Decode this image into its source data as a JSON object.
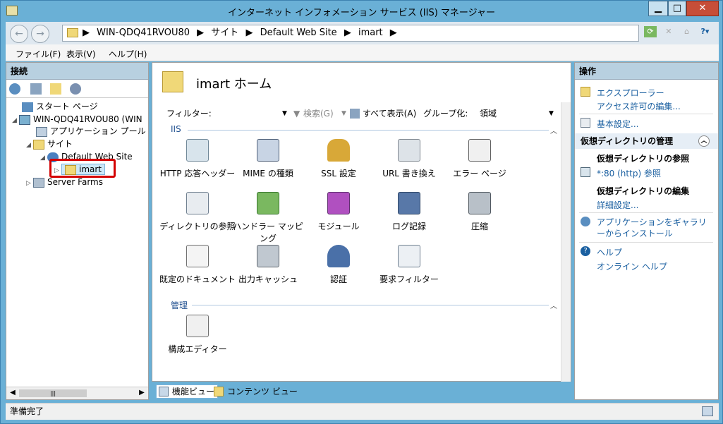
{
  "window": {
    "title": "インターネット インフォメーション サービス (IIS) マネージャー",
    "buttons": {
      "minimize": "▁",
      "maximize": "□",
      "close": "✕"
    }
  },
  "address": {
    "crumbs": [
      "WIN-QDQ41RVOU80",
      "サイト",
      "Default Web Site",
      "imart"
    ],
    "separator": "▶"
  },
  "menu": [
    "ファイル(F)",
    "表示(V)",
    "ヘルプ(H)"
  ],
  "connections": {
    "title": "接続",
    "tree": [
      {
        "label": "スタート ページ"
      },
      {
        "label": "WIN-QDQ41RVOU80 (WIN"
      },
      {
        "label": "アプリケーション プール"
      },
      {
        "label": "サイト"
      },
      {
        "label": "Default Web Site"
      },
      {
        "label": "imart"
      },
      {
        "label": "Server Farms"
      }
    ]
  },
  "home": {
    "title": "imart ホーム",
    "filter_label": "フィルター:",
    "search_label": "検索(G)",
    "show_all_label": "すべて表示(A)",
    "group_label": "グループ化:",
    "group_value": "領域"
  },
  "sections": {
    "iis": "IIS",
    "management": "管理"
  },
  "features": [
    {
      "label": "HTTP 応答ヘッダー"
    },
    {
      "label": "MIME の種類"
    },
    {
      "label": "SSL 設定"
    },
    {
      "label": "URL 書き換え"
    },
    {
      "label": "エラー ページ"
    },
    {
      "label": "ディレクトリの参照"
    },
    {
      "label": "ハンドラー マッピング"
    },
    {
      "label": "モジュール"
    },
    {
      "label": "ログ記録"
    },
    {
      "label": "圧縮"
    },
    {
      "label": "既定のドキュメント"
    },
    {
      "label": "出力キャッシュ"
    },
    {
      "label": "認証"
    },
    {
      "label": "要求フィルター"
    }
  ],
  "management_features": [
    {
      "label": "構成エディター"
    }
  ],
  "views": {
    "features": "機能ビュー",
    "content": "コンテンツ ビュー"
  },
  "actions": {
    "title": "操作",
    "explore": "エクスプローラー",
    "edit_permissions": "アクセス許可の編集...",
    "basic_settings": "基本設定...",
    "vdir_section": "仮想ディレクトリの管理",
    "browse_vdir": "仮想ディレクトリの参照",
    "browse_link": "*:80 (http) 参照",
    "edit_vdir": "仮想ディレクトリの編集",
    "advanced": "詳細設定...",
    "gallery": "アプリケーションをギャラリーからインストール",
    "help": "ヘルプ",
    "online_help": "オンライン ヘルプ"
  },
  "status": {
    "text": "準備完了"
  },
  "colors": {
    "titlebar": "#6ab0d6",
    "link": "#1a5fa0",
    "highlight_box": "#d40000"
  }
}
